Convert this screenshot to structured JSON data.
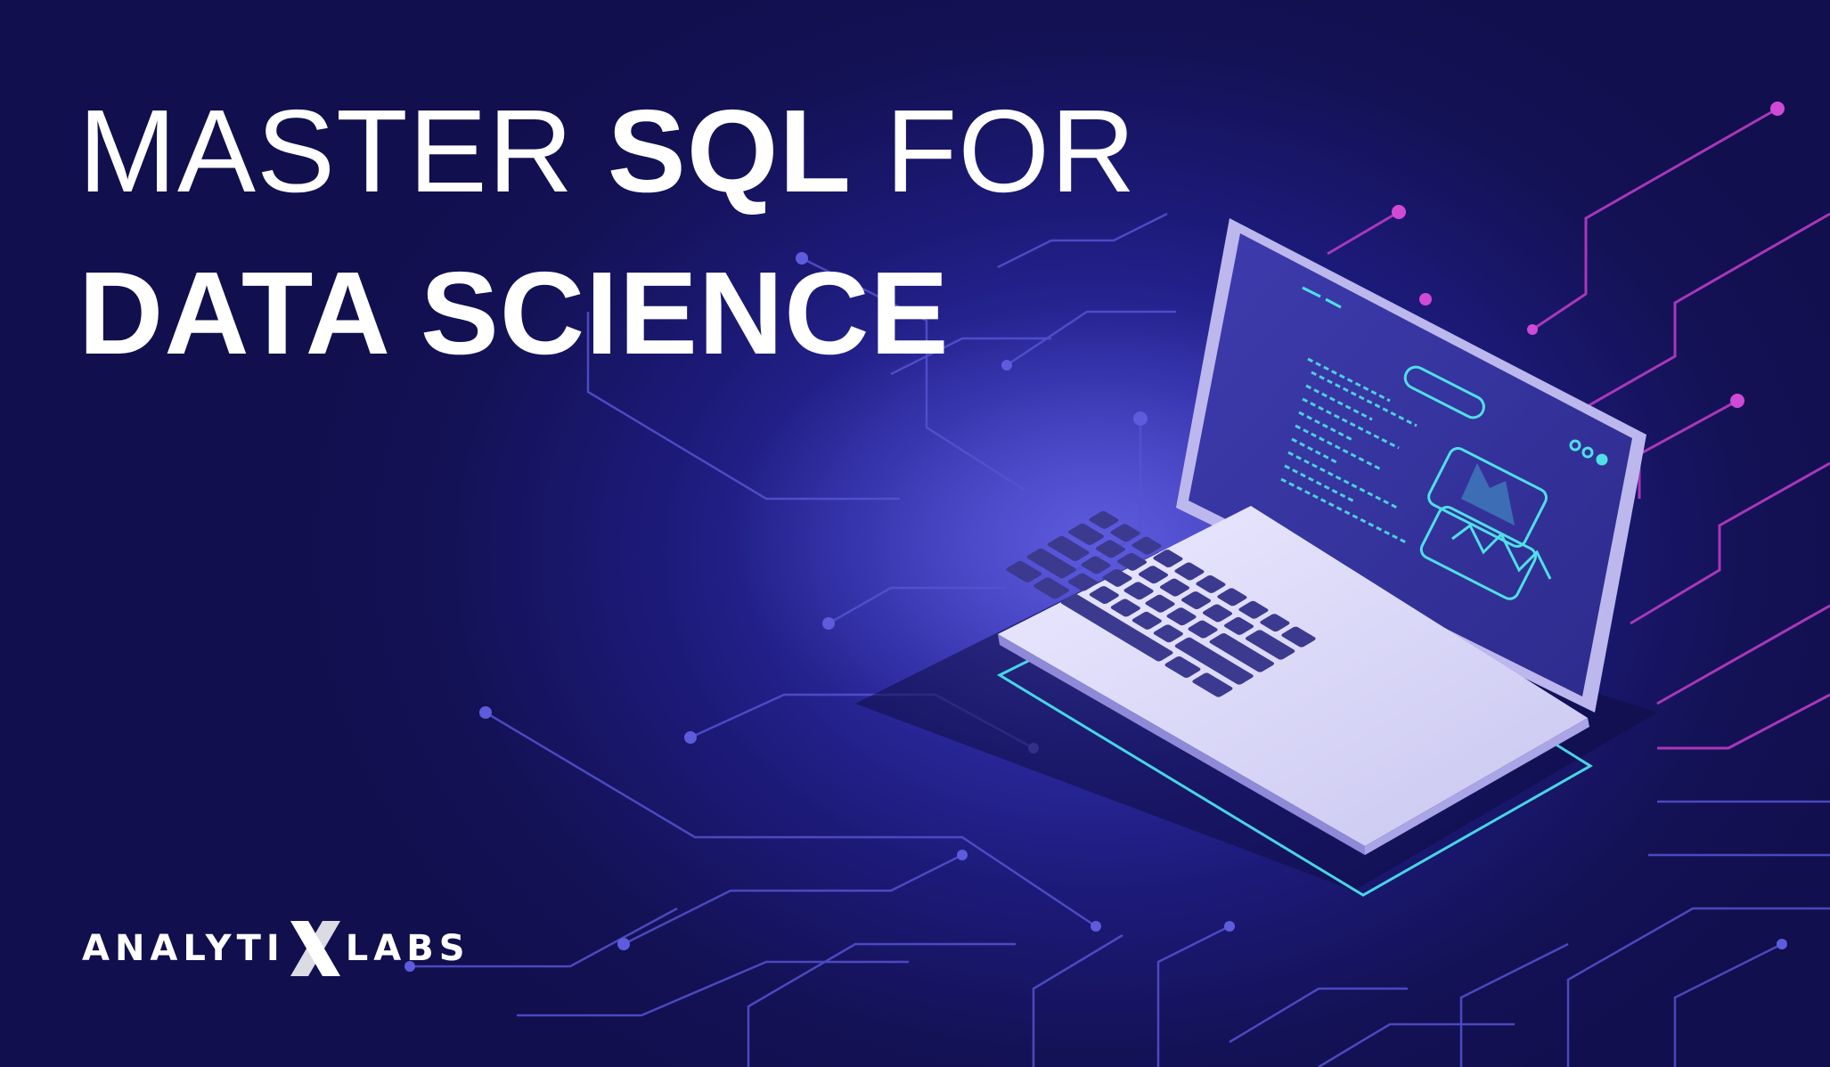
{
  "headline": {
    "line1_part1": "MASTER ",
    "line1_bold": "SQL",
    "line1_part2": " FOR",
    "line2": "DATA SCIENCE"
  },
  "brand": {
    "logo_text_left": "ANALYTI",
    "logo_text_right": "LABS",
    "logo_mark": "X"
  },
  "colors": {
    "background": "#15135a",
    "circuit_lines": "#5a58d8",
    "circuit_accent": "#c040c8",
    "laptop_body": "#d8d6f4",
    "screen": "#3b3aa6",
    "cyan_accent": "#4fe0e8"
  }
}
